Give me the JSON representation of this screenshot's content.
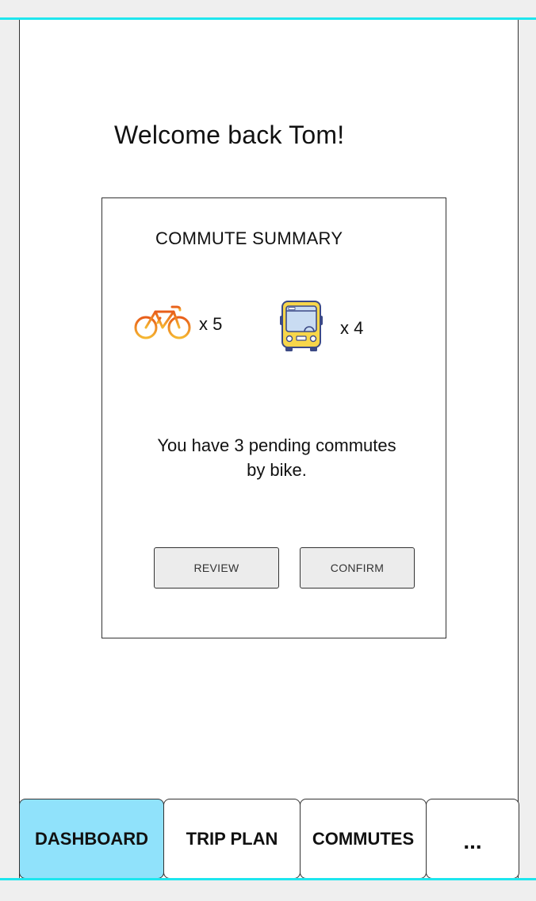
{
  "greeting": "Welcome back Tom!",
  "summary": {
    "title": "COMMUTE SUMMARY",
    "bike_count": "x 5",
    "bus_count": "x 4",
    "pending_line1": "You have 3 pending commutes",
    "pending_line2": "by bike.",
    "review_label": "REVIEW",
    "confirm_label": "CONFIRM"
  },
  "tabs": {
    "dashboard": "DASHBOARD",
    "trip_plan": "TRIP PLAN",
    "commutes": "COMMUTES",
    "more": "..."
  },
  "colors": {
    "accent_line": "#1ee6ee",
    "active_tab": "#90e2fb",
    "bike_icon": "#f08c1e",
    "bus_icon": "#f7d64a"
  },
  "icons": {
    "bike": "bike-icon",
    "bus": "bus-icon"
  },
  "active_tab": "dashboard"
}
